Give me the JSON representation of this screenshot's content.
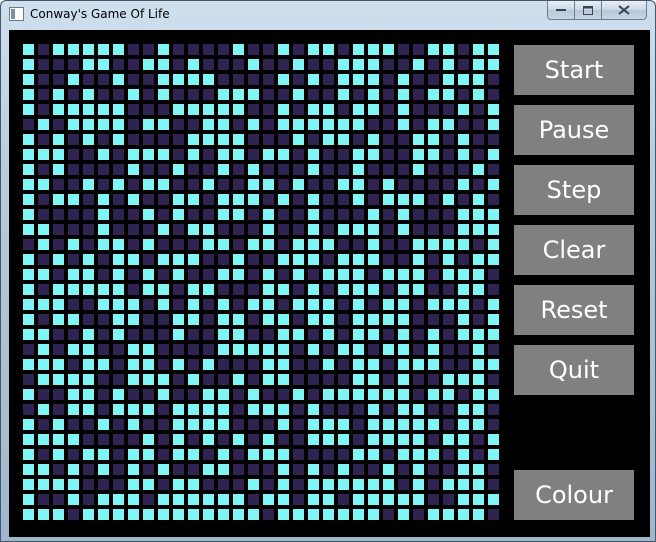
{
  "window": {
    "title": "Conway's Game Of Life",
    "controls": {
      "minimize": "minimize-icon",
      "maximize": "maximize-icon",
      "close": "close-icon"
    }
  },
  "colors": {
    "background": "#000000",
    "alive": "#7ff5f5",
    "dead": "#2f2352",
    "button_bg": "#808080",
    "button_text": "#ffffff"
  },
  "controls": {
    "start": "Start",
    "pause": "Pause",
    "step": "Step",
    "clear": "Clear",
    "reset": "Reset",
    "quit": "Quit",
    "colour": "Colour"
  },
  "board": {
    "cols": 32,
    "rows": 32,
    "cells": [
      "10111110010000100101101110011011",
      "10001100110100010010011100101011",
      "10010010011110000101011101001110",
      "10101001010001110010010101011010",
      "10111110001111100101101101000101",
      "01011110110011010111111001011001",
      "10101010000111100010110100110100",
      "11100101110101101101001100110101",
      "10100001001001010001001000100010",
      "11001010110010011010011010000101",
      "10110101001101110101001011101010",
      "10000100101001101001000101000111",
      "11000100010110001001011101000111",
      "01010110100011011011100100111101",
      "10101011011100100111011100101011",
      "11011010101001101010111011101110",
      "10111110110110001101011101100110",
      "11100111010101011011101011011101",
      "10110011001101101101101111000101",
      "11001010001001100110101101010111",
      "01011001100001111101011011010010",
      "11101101101010001100101101110011",
      "01111001110100101100001101001110",
      "10011010010011010010111111011011",
      "01011011101111011101000101100110",
      "10100101001111000101110111110110",
      "11110000101010101001110111101101",
      "10101101101101011100001101110101",
      "11010101010011000101010010100110",
      "11110001101100010101111110101110",
      "10010111011111101101101111100111",
      "11101111111111110111111101011110"
    ]
  }
}
